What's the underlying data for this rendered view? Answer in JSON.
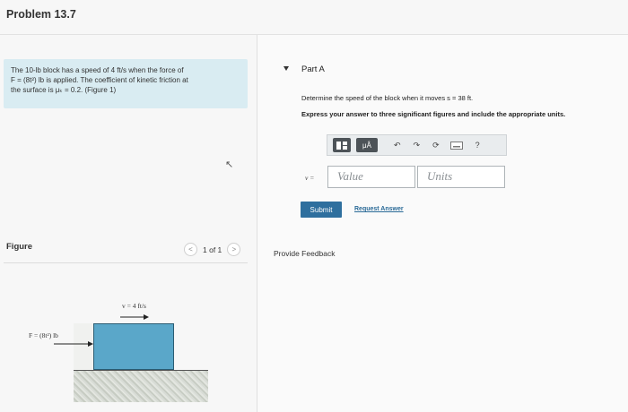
{
  "header": {
    "title": "Problem 13.7"
  },
  "intro": {
    "line1": "The 10-lb block has a speed of 4 ft/s when the force of",
    "line2": "F = (8t²) lb is applied. The coefficient of kinetic friction at",
    "line3": "the surface is μₖ = 0.2. (Figure 1)"
  },
  "figure": {
    "label": "Figure",
    "pager": {
      "prev": "<",
      "text": "1 of 1",
      "next": ">"
    },
    "velocity_label": "v = 4 ft/s",
    "force_label": "F = (8t²) lb"
  },
  "part": {
    "title": "Part A",
    "question": "Determine the speed of the block when it moves s = 38 ft.",
    "instructions": "Express your answer to three significant figures and include the appropriate units."
  },
  "toolbar": {
    "templates_icon": "templates-icon",
    "mu_label": "μÅ",
    "undo_icon": "↶",
    "redo_icon": "↷",
    "reset_icon": "⟳",
    "keyboard_icon": "keyboard-icon",
    "help_label": "?"
  },
  "answer": {
    "label": "v =",
    "value_placeholder": "Value",
    "units_placeholder": "Units"
  },
  "actions": {
    "submit": "Submit",
    "request": "Request Answer",
    "feedback": "Provide Feedback"
  }
}
